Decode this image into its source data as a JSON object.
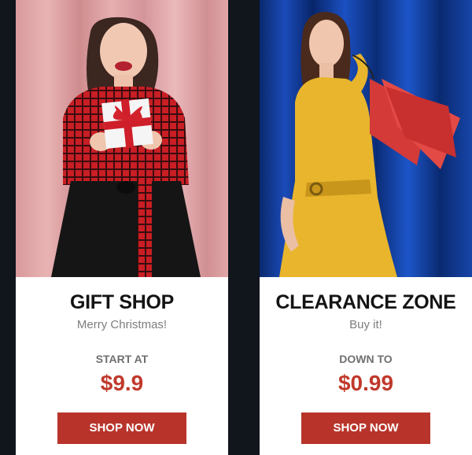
{
  "cards": [
    {
      "title": "GIFT SHOP",
      "subtitle": "Merry Christmas!",
      "price_label": "START AT",
      "price": "$9.9",
      "button_label": "SHOP NOW",
      "photo": "woman-holding-gift-box-red-curtain"
    },
    {
      "title": "CLEARANCE ZONE",
      "subtitle": "Buy it!",
      "price_label": "DOWN TO",
      "price": "$0.99",
      "button_label": "SHOP NOW",
      "photo": "woman-with-shopping-bags-blue-curtain"
    }
  ],
  "colors": {
    "page_background": "#11151c",
    "price": "#c0392b",
    "button": "#b8342b",
    "card": "#ffffff"
  }
}
